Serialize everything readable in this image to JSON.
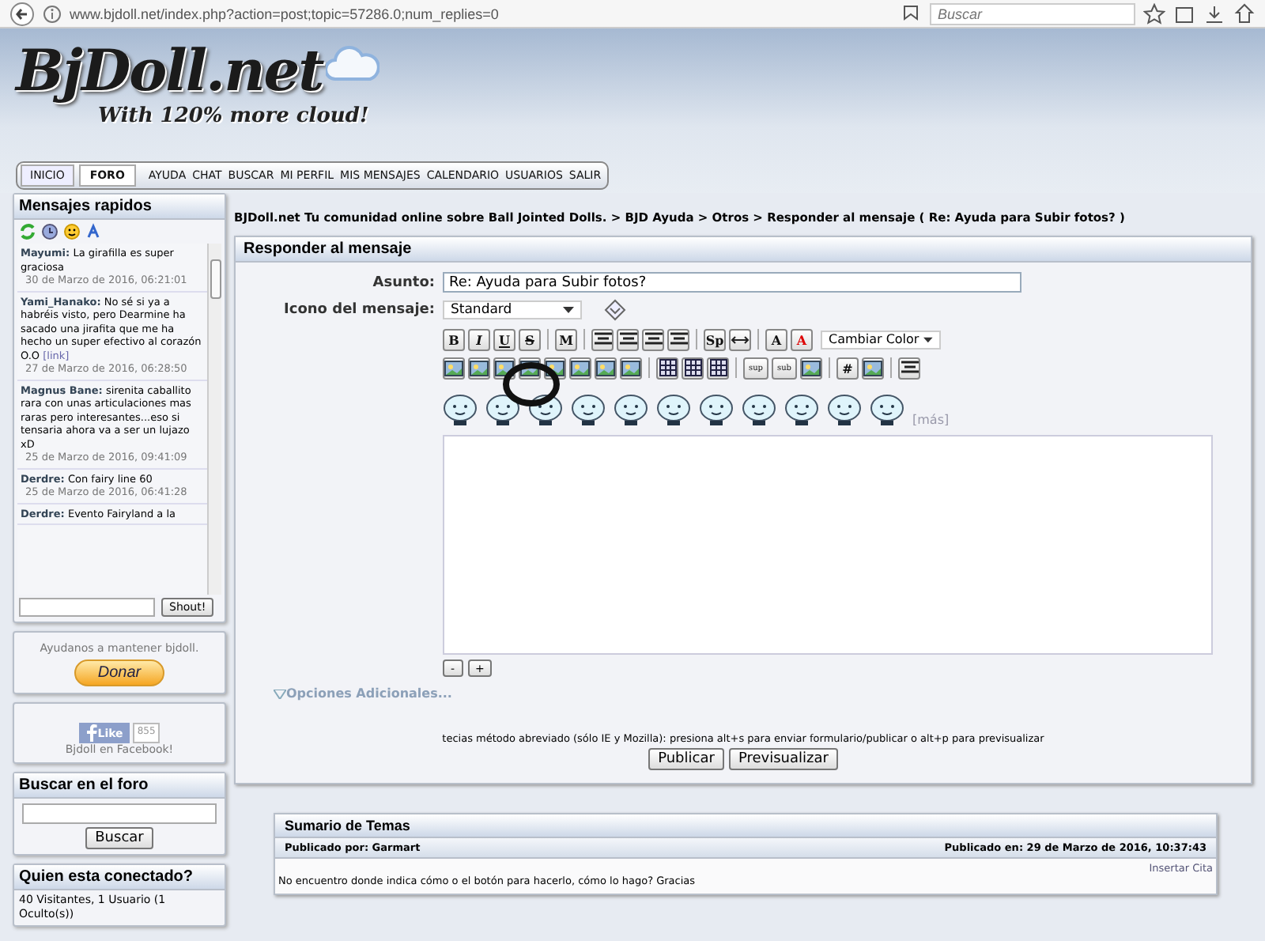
{
  "browser": {
    "url": "www.bjdoll.net/index.php?action=post;topic=57286.0;num_replies=0",
    "search": {
      "placeholder": "Buscar"
    }
  },
  "header": {
    "logo": "BjDoll.net",
    "tagline": "With 120% more cloud!"
  },
  "nav": [
    {
      "label": "INICIO",
      "selected": false
    },
    {
      "label": "FORO",
      "selected": true
    },
    {
      "label": "AYUDA",
      "selected": false
    },
    {
      "label": "CHAT",
      "selected": false
    },
    {
      "label": "BUSCAR",
      "selected": false
    },
    {
      "label": "MI PERFIL",
      "selected": false
    },
    {
      "label": "MIS MENSAJES",
      "selected": false
    },
    {
      "label": "CALENDARIO",
      "selected": false
    },
    {
      "label": "USUARIOS",
      "selected": false
    },
    {
      "label": "SALIR",
      "selected": false
    }
  ],
  "shoutbox": {
    "title": "Mensajes rapidos",
    "messages": [
      {
        "author": "Mayumi:",
        "text": "La girafilla es super graciosa",
        "date": "30 de Marzo de 2016, 06:21:01"
      },
      {
        "author": "Yami_Hanako:",
        "text": "No sé si ya a habréis visto, pero Dearmine ha sacado una jirafita que me ha hecho un super efectivo al corazón O.O",
        "link": "[link]",
        "date": "27 de Marzo de 2016, 06:28:50"
      },
      {
        "author": "Magnus Bane:",
        "text": "sirenita caballito rara con unas articulaciones mas raras pero interesantes...eso si tensaria ahora va a ser un lujazo xD",
        "date": "25 de Marzo de 2016, 09:41:09"
      },
      {
        "author": "Derdre:",
        "text": "Con fairy line 60",
        "date": "25 de Marzo de 2016, 06:41:28"
      },
      {
        "author": "Derdre:",
        "text": "Evento Fairyland a la"
      }
    ],
    "button": "Shout!"
  },
  "donate": {
    "text": "Ayudanos a mantener bjdoll.",
    "button": "Donar"
  },
  "facebook": {
    "like": "Like",
    "count": "855",
    "text": "Bjdoll en Facebook!"
  },
  "search_box": {
    "title": "Buscar en el foro",
    "button": "Buscar"
  },
  "online": {
    "title": "Quien esta conectado?",
    "text": "40 Visitantes, 1 Usuario (1 Oculto(s))"
  },
  "breadcrumb": "BJDoll.net Tu comunidad online sobre Ball Jointed Dolls. > BJD Ayuda > Otros > Responder al mensaje ( Re: Ayuda para Subir fotos? )",
  "reply": {
    "title": "Responder al mensaje",
    "subject_label": "Asunto:",
    "subject": "Re: Ayuda para Subir fotos?",
    "icon_label": "Icono del mensaje:",
    "icon_value": "Standard",
    "toolbar1": [
      {
        "kind": "bold",
        "label": "B"
      },
      {
        "kind": "italic",
        "label": "I"
      },
      {
        "kind": "underline",
        "label": "U"
      },
      {
        "kind": "strike",
        "label": "S"
      },
      {
        "kind": "sep"
      },
      {
        "kind": "bold",
        "label": "M"
      },
      {
        "kind": "sep"
      },
      {
        "kind": "lines"
      },
      {
        "kind": "lines"
      },
      {
        "kind": "lines"
      },
      {
        "kind": "lines"
      },
      {
        "kind": "sep"
      },
      {
        "kind": "bold",
        "label": "Sp"
      },
      {
        "kind": "arrows"
      },
      {
        "kind": "sep"
      },
      {
        "kind": "bold",
        "label": "A"
      },
      {
        "kind": "red",
        "label": "A"
      }
    ],
    "color_select": "Cambiar Color",
    "toolbar2": [
      {
        "kind": "image"
      },
      {
        "kind": "image"
      },
      {
        "kind": "image"
      },
      {
        "kind": "image"
      },
      {
        "kind": "image"
      },
      {
        "kind": "image"
      },
      {
        "kind": "image"
      },
      {
        "kind": "image"
      },
      {
        "kind": "sep"
      },
      {
        "kind": "grid"
      },
      {
        "kind": "grid"
      },
      {
        "kind": "grid"
      },
      {
        "kind": "sep"
      },
      {
        "kind": "small",
        "label": "sup"
      },
      {
        "kind": "small",
        "label": "sub"
      },
      {
        "kind": "image"
      },
      {
        "kind": "sep"
      },
      {
        "kind": "bold",
        "label": "#"
      },
      {
        "kind": "image"
      },
      {
        "kind": "sep"
      },
      {
        "kind": "lines"
      }
    ],
    "smileys": [
      {
        "kind": "smiley"
      },
      {
        "kind": "smiley"
      },
      {
        "kind": "smiley"
      },
      {
        "kind": "smiley"
      },
      {
        "kind": "smiley"
      },
      {
        "kind": "smiley"
      },
      {
        "kind": "smiley"
      },
      {
        "kind": "smiley"
      },
      {
        "kind": "smiley"
      },
      {
        "kind": "smiley"
      },
      {
        "kind": "smiley"
      }
    ],
    "more": "[más]",
    "shrink": "-",
    "grow": "+",
    "options": "Opciones Adicionales...",
    "hint": "tecias método abreviado (sólo IE y Mozilla): presiona alt+s para enviar formulario/publicar o alt+p para previsualizar",
    "buttons": [
      "Publicar",
      "Previsualizar"
    ]
  },
  "summary": {
    "title": "Sumario de Temas",
    "by": "Publicado por: Garmart",
    "date": "Publicado en: 29 de Marzo de 2016, 10:37:43",
    "quote": "Insertar Cita",
    "text": "No encuentro donde indica cómo o el botón para hacerlo, cómo lo hago? Gracias"
  }
}
